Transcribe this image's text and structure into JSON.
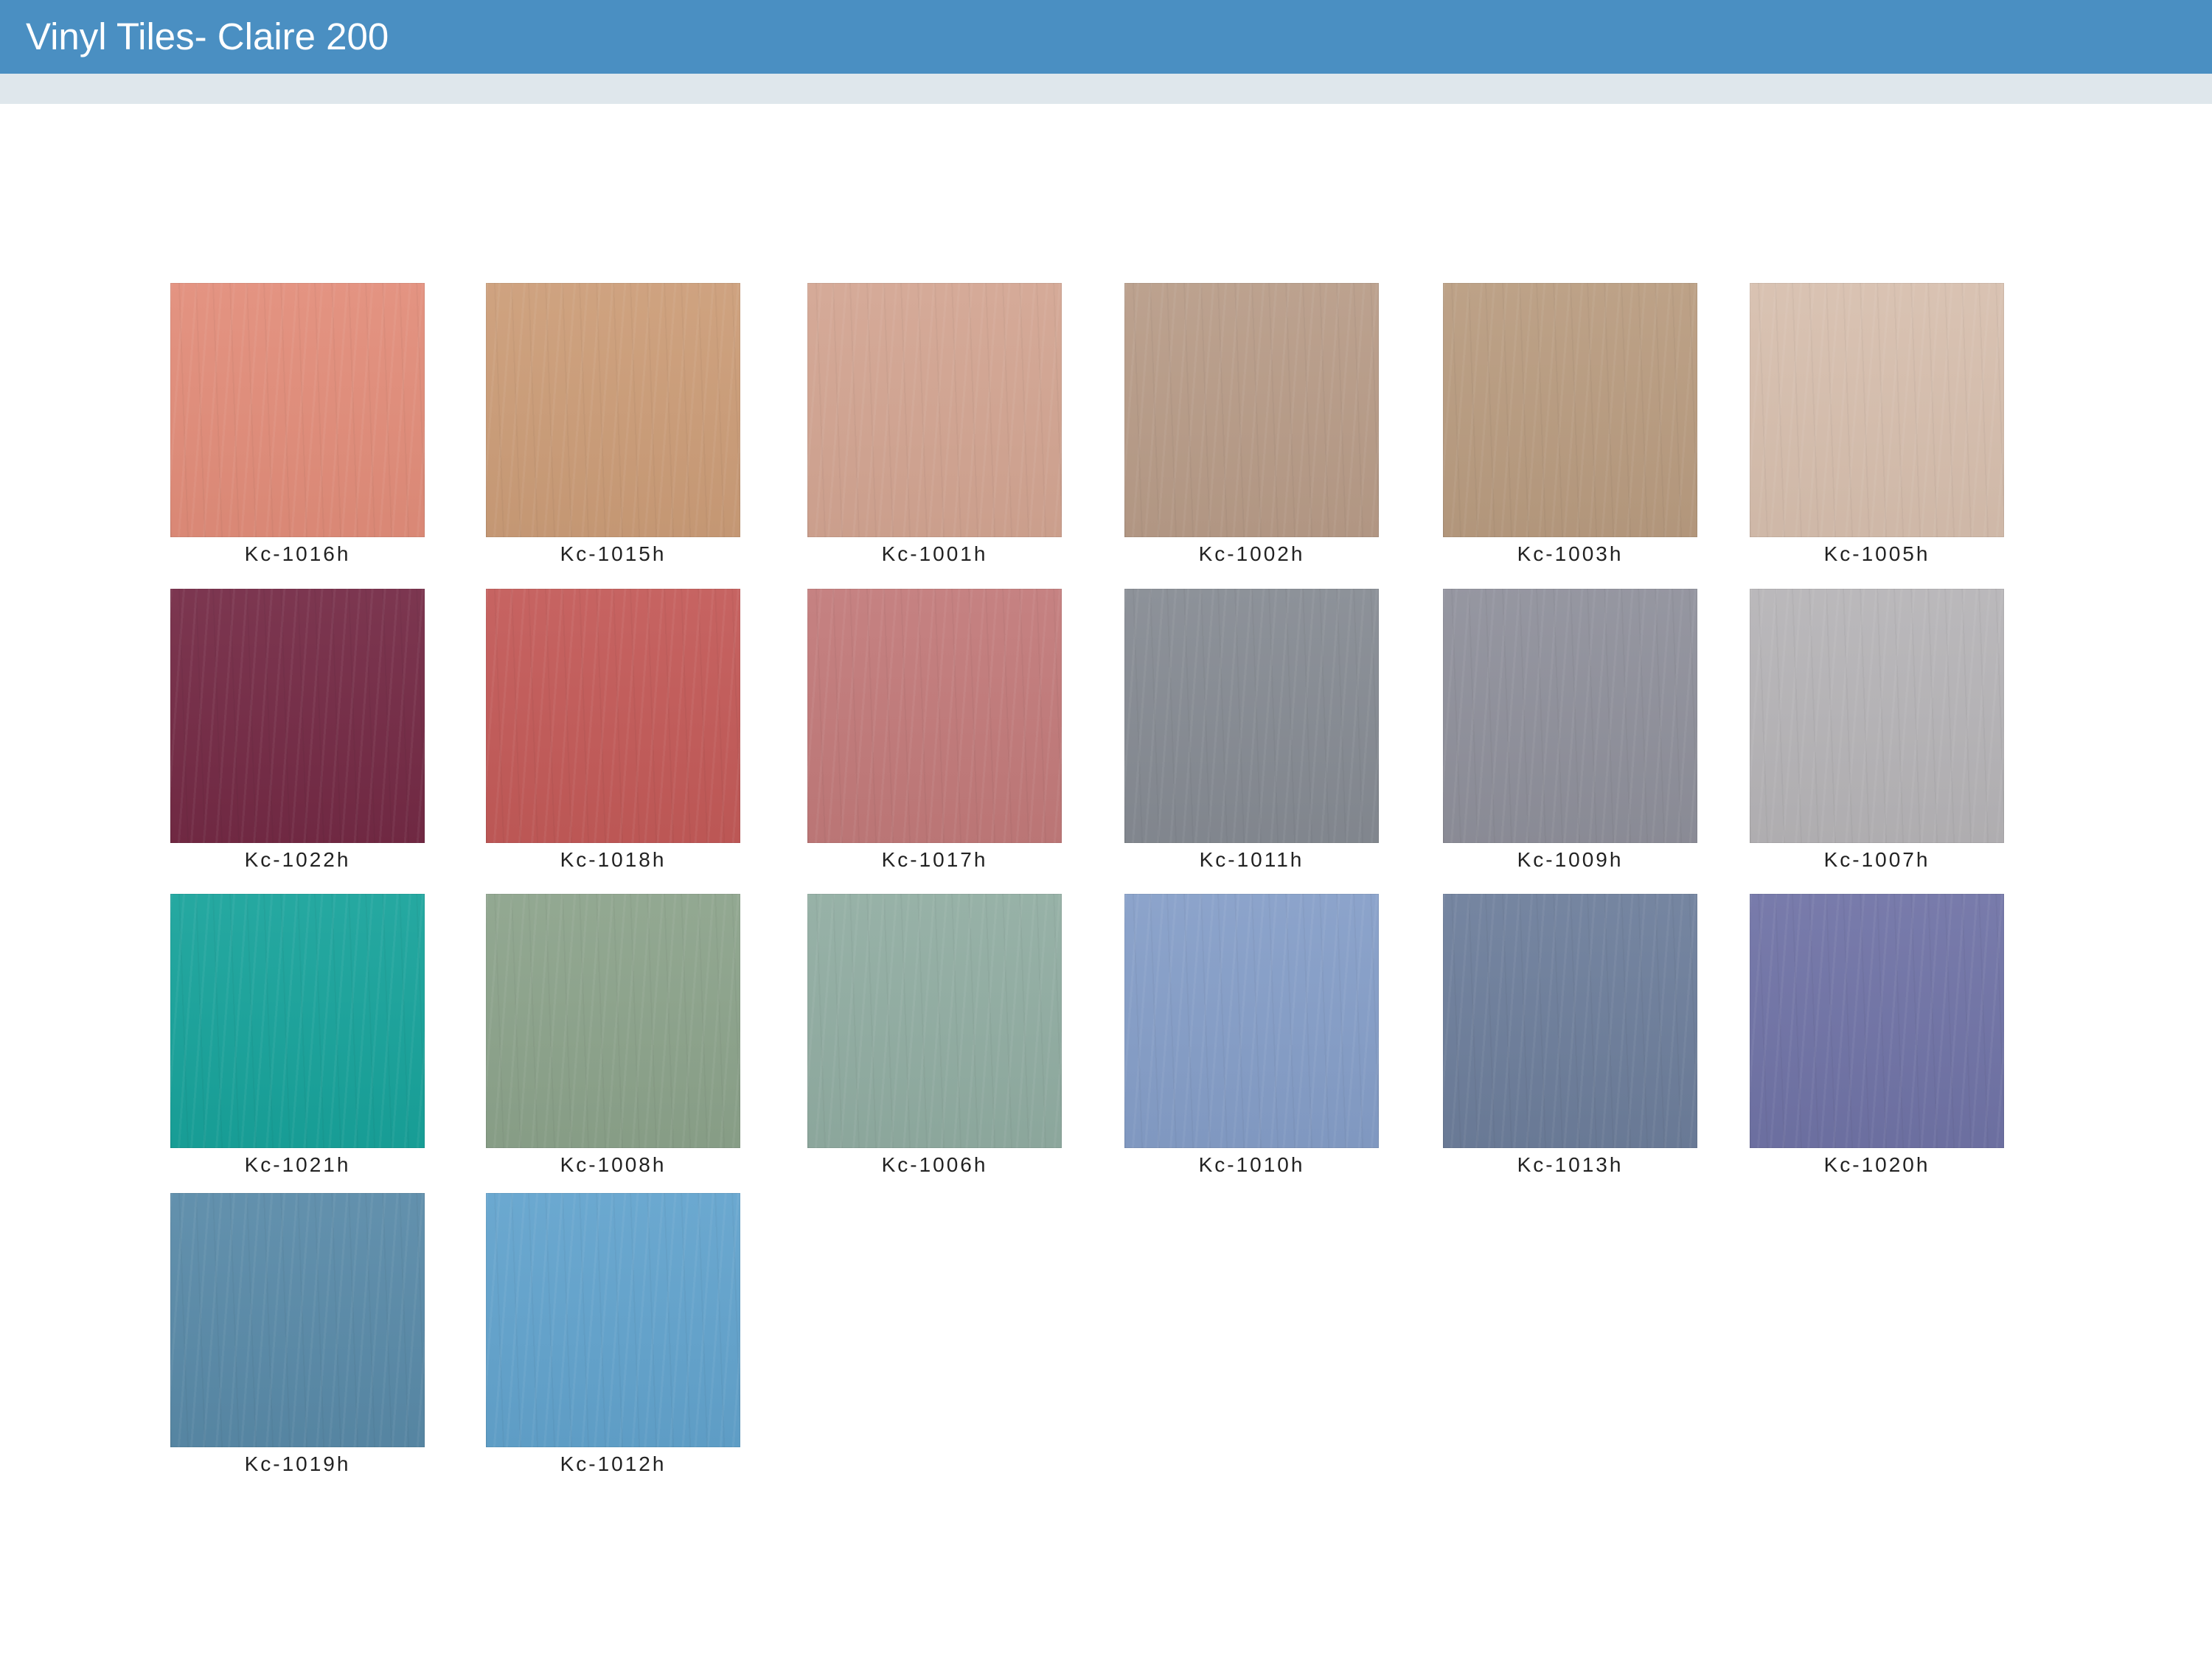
{
  "header": {
    "title": "Vinyl Tiles- Claire 200",
    "bar_color": "#4a8fc2",
    "band_color": "#dfe7ec"
  },
  "tiles": [
    {
      "code": "Kc-1016h",
      "color": "#e28d7a"
    },
    {
      "code": "Kc-1015h",
      "color": "#cc9d78"
    },
    {
      "code": "Kc-1001h",
      "color": "#d3a592"
    },
    {
      "code": "Kc-1002h",
      "color": "#b89c88"
    },
    {
      "code": "Kc-1003h",
      "color": "#b99c80"
    },
    {
      "code": "Kc-1005h",
      "color": "#d7bfae"
    },
    {
      "code": "Kc-1022h",
      "color": "#742a45"
    },
    {
      "code": "Kc-1018h",
      "color": "#c35a58"
    },
    {
      "code": "Kc-1017h",
      "color": "#c27a7a"
    },
    {
      "code": "Kc-1011h",
      "color": "#868b93"
    },
    {
      "code": "Kc-1009h",
      "color": "#8f909b"
    },
    {
      "code": "Kc-1007h",
      "color": "#b6b4b7"
    },
    {
      "code": "Kc-1021h",
      "color": "#18a39b"
    },
    {
      "code": "Kc-1008h",
      "color": "#8ca38b"
    },
    {
      "code": "Kc-1006h",
      "color": "#91ada2"
    },
    {
      "code": "Kc-1010h",
      "color": "#859ec8"
    },
    {
      "code": "Kc-1013h",
      "color": "#6d7e9b"
    },
    {
      "code": "Kc-1020h",
      "color": "#7073a6"
    },
    {
      "code": "Kc-1019h",
      "color": "#598aa8"
    },
    {
      "code": "Kc-1012h",
      "color": "#62a3cd"
    }
  ]
}
